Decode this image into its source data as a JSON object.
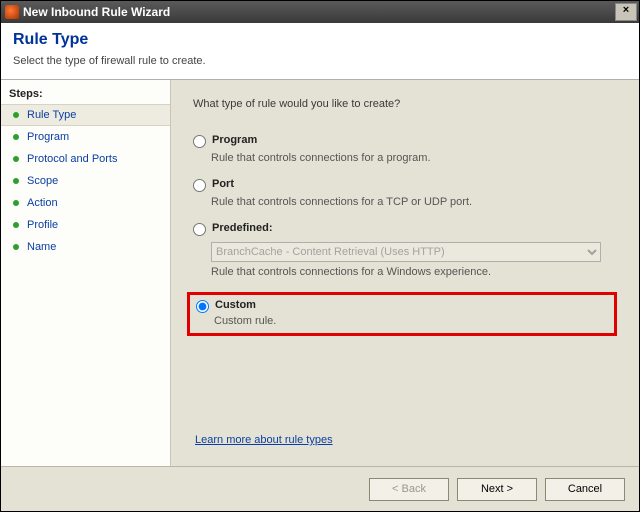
{
  "window": {
    "title": "New Inbound Rule Wizard",
    "close_label": "×"
  },
  "header": {
    "title": "Rule Type",
    "subtitle": "Select the type of firewall rule to create."
  },
  "sidebar": {
    "title": "Steps:",
    "items": [
      {
        "label": "Rule Type",
        "current": true
      },
      {
        "label": "Program"
      },
      {
        "label": "Protocol and Ports"
      },
      {
        "label": "Scope"
      },
      {
        "label": "Action"
      },
      {
        "label": "Profile"
      },
      {
        "label": "Name"
      }
    ]
  },
  "content": {
    "prompt": "What type of rule would you like to create?",
    "options": {
      "program": {
        "title": "Program",
        "desc": "Rule that controls connections for a program."
      },
      "port": {
        "title": "Port",
        "desc": "Rule that controls connections for a TCP or UDP port."
      },
      "predefined": {
        "title": "Predefined:",
        "selected": "BranchCache - Content Retrieval (Uses HTTP)",
        "desc": "Rule that controls connections for a Windows experience."
      },
      "custom": {
        "title": "Custom",
        "desc": "Custom rule."
      }
    },
    "selected_option": "custom",
    "learn_link": "Learn more about rule types"
  },
  "footer": {
    "back": "< Back",
    "next": "Next >",
    "cancel": "Cancel"
  }
}
